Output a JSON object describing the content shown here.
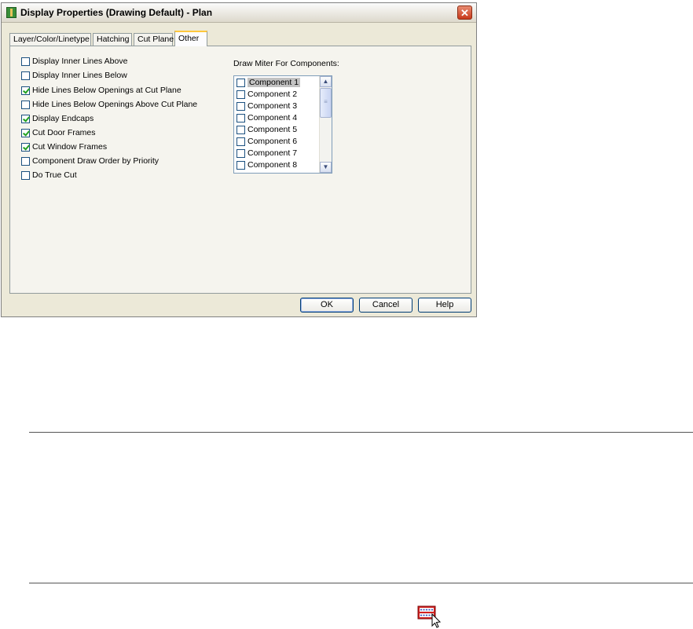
{
  "dialog": {
    "title": "Display Properties (Drawing Default) - Plan",
    "close_symbol": "✕",
    "tabs": [
      {
        "label": "Layer/Color/Linetype"
      },
      {
        "label": "Hatching"
      },
      {
        "label": "Cut Plane"
      },
      {
        "label": "Other",
        "active": true
      }
    ],
    "options": [
      {
        "label": "Display Inner Lines Above",
        "checked": false
      },
      {
        "label": "Display Inner Lines Below",
        "checked": false
      },
      {
        "label": "Hide Lines Below Openings at Cut Plane",
        "checked": true
      },
      {
        "label": "Hide Lines Below Openings Above Cut Plane",
        "checked": false
      },
      {
        "label": "Display Endcaps",
        "checked": true
      },
      {
        "label": "Cut Door Frames",
        "checked": true
      },
      {
        "label": "Cut Window Frames",
        "checked": true
      },
      {
        "label": "Component Draw Order by Priority",
        "checked": false
      },
      {
        "label": "Do True Cut",
        "checked": false
      }
    ],
    "miter": {
      "label": "Draw Miter For Components:",
      "items": [
        {
          "label": "Component 1",
          "checked": false,
          "selected": true
        },
        {
          "label": "Component 2",
          "checked": false
        },
        {
          "label": "Component 3",
          "checked": false
        },
        {
          "label": "Component 4",
          "checked": false
        },
        {
          "label": "Component 5",
          "checked": false
        },
        {
          "label": "Component 6",
          "checked": false
        },
        {
          "label": "Component 7",
          "checked": false
        },
        {
          "label": "Component 8",
          "checked": false
        }
      ],
      "scroll_up_symbol": "▲",
      "scroll_down_symbol": "▼",
      "thumb_grip_symbol": "≡"
    },
    "buttons": {
      "ok": "OK",
      "cancel": "Cancel",
      "help": "Help"
    }
  },
  "icons": {
    "title_icon": "display-properties-icon",
    "toolbar_icon": "edit-display-properties-icon"
  },
  "colors": {
    "dialog_bg": "#ece9d8",
    "active_tab_accent": "#ffc83c",
    "check_green": "#21a121",
    "close_red": "#c8391b"
  }
}
